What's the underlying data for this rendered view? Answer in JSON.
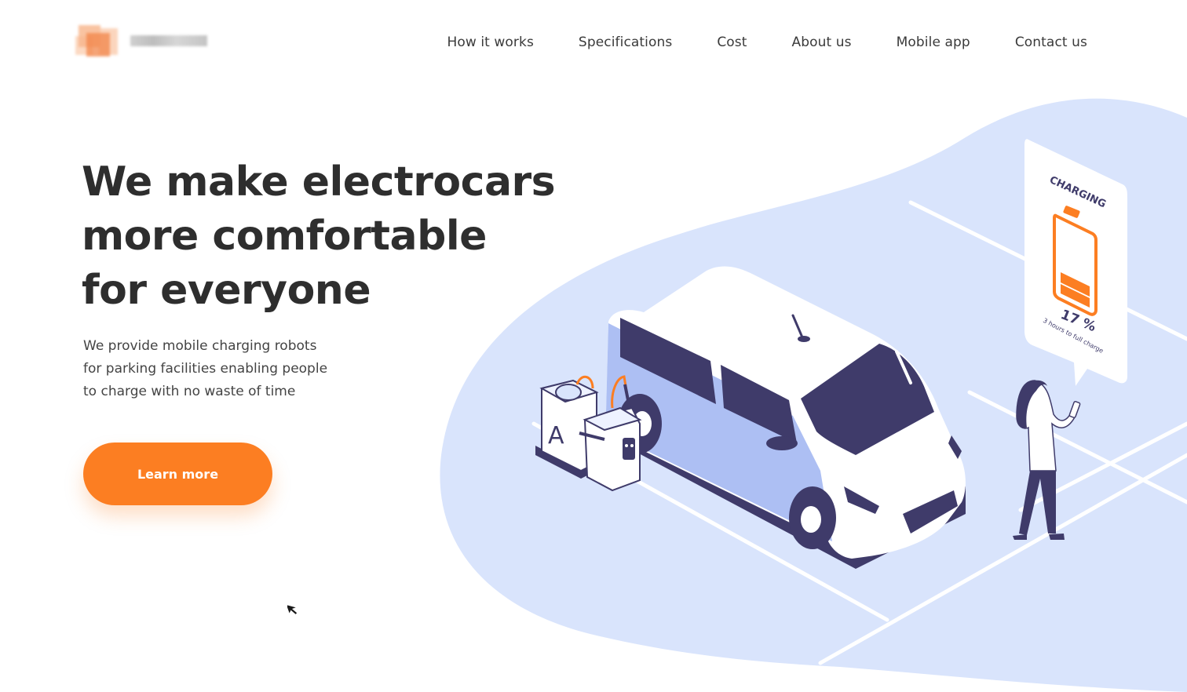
{
  "nav": {
    "items": [
      {
        "label": "How it works"
      },
      {
        "label": "Specifications"
      },
      {
        "label": "Cost"
      },
      {
        "label": "About us"
      },
      {
        "label": "Mobile app"
      },
      {
        "label": "Contact us"
      }
    ]
  },
  "hero": {
    "title_lines": [
      "We make electrocars",
      "more comfortable",
      "for everyone"
    ],
    "subtitle_lines": [
      "We provide mobile charging robots",
      "for parking facilities enabling people",
      "to charge with no waste of time"
    ],
    "cta_label": "Learn more"
  },
  "illustration": {
    "charging_label": "CHARGING",
    "battery_percent_text": "17 %",
    "battery_level": 0.17,
    "time_to_full": "3 hours to full charge",
    "robot_label": "A"
  },
  "colors": {
    "accent": "#fc7e22",
    "blob": "#d9e4fc",
    "van_dark": "#3f3b6a",
    "van_light": "#adbff3",
    "text_dark": "#2e2e2e"
  }
}
